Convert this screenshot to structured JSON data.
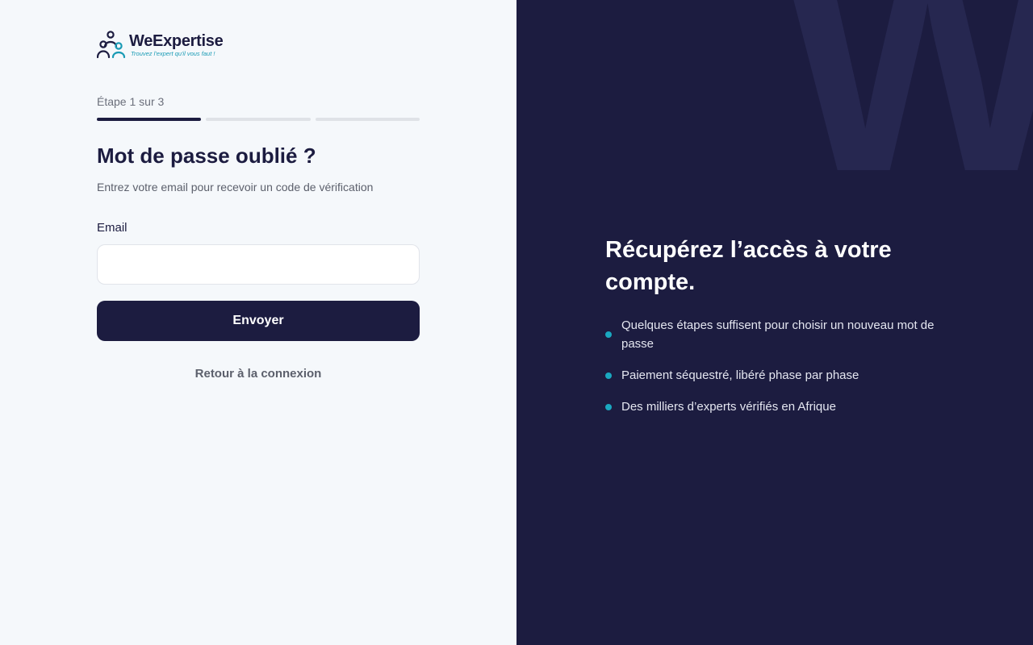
{
  "logo": {
    "name": "WeExpertise",
    "tagline": "Trouvez l'expert qu'il vous faut !",
    "colors": {
      "navy": "#1c1c40",
      "teal": "#1a9bb5"
    }
  },
  "progress": {
    "label": "Étape 1 sur 3",
    "current": 1,
    "total": 3
  },
  "form": {
    "title": "Mot de passe oublié ?",
    "subtitle": "Entrez votre email pour recevoir un code de vérification",
    "email_label": "Email",
    "email_value": "",
    "email_placeholder": "",
    "submit_label": "Envoyer",
    "back_link": "Retour à la connexion"
  },
  "aside": {
    "watermark": "WE",
    "title": "Récupérez l’accès à votre compte.",
    "bullets": [
      "Quelques étapes suffisent pour choisir un nouveau mot de passe",
      "Paiement séquestré, libéré phase par phase",
      "Des milliers d’experts vérifiés en Afrique"
    ],
    "bullet_color": "#1aa8c0"
  },
  "colors": {
    "left_bg": "#f5f8fb",
    "right_bg": "#1c1c40",
    "primary": "#1c1c40"
  }
}
